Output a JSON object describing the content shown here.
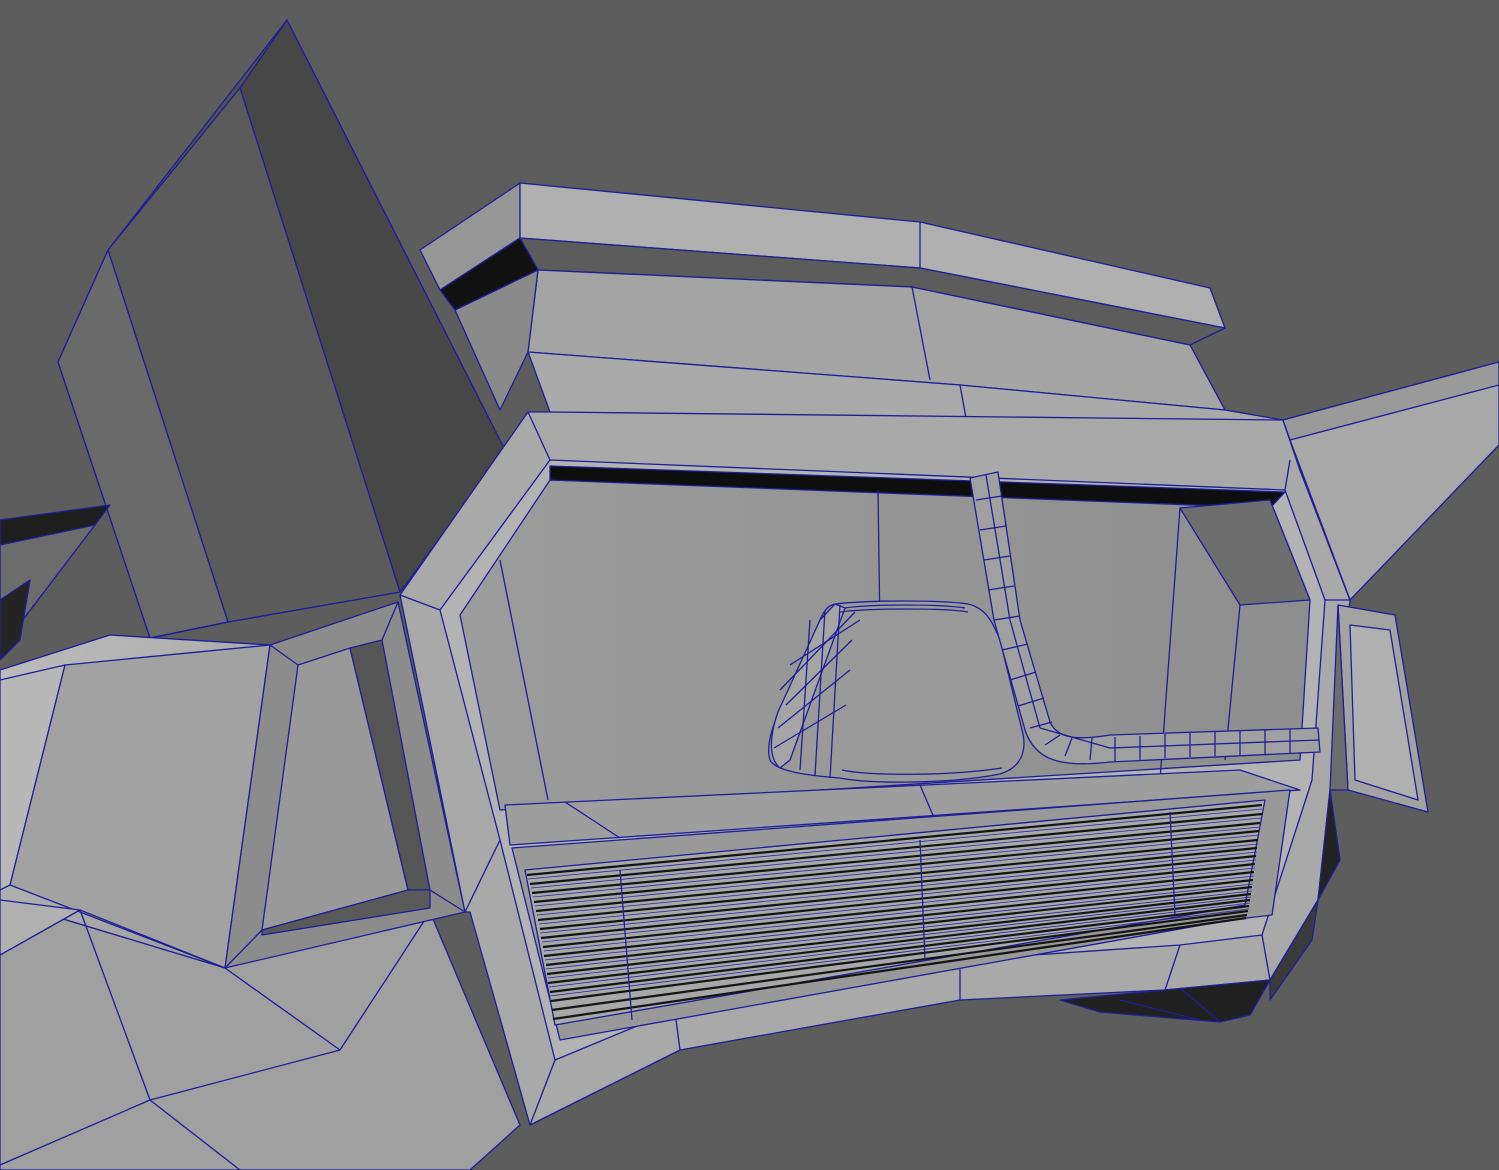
{
  "viewport": {
    "background": "#5d5d5d",
    "wire_color": "#1e1e96",
    "shade_light": "#a6a6a6",
    "shade_mid": "#949494",
    "shade_dark": "#474747",
    "shade_black": "#141414"
  }
}
